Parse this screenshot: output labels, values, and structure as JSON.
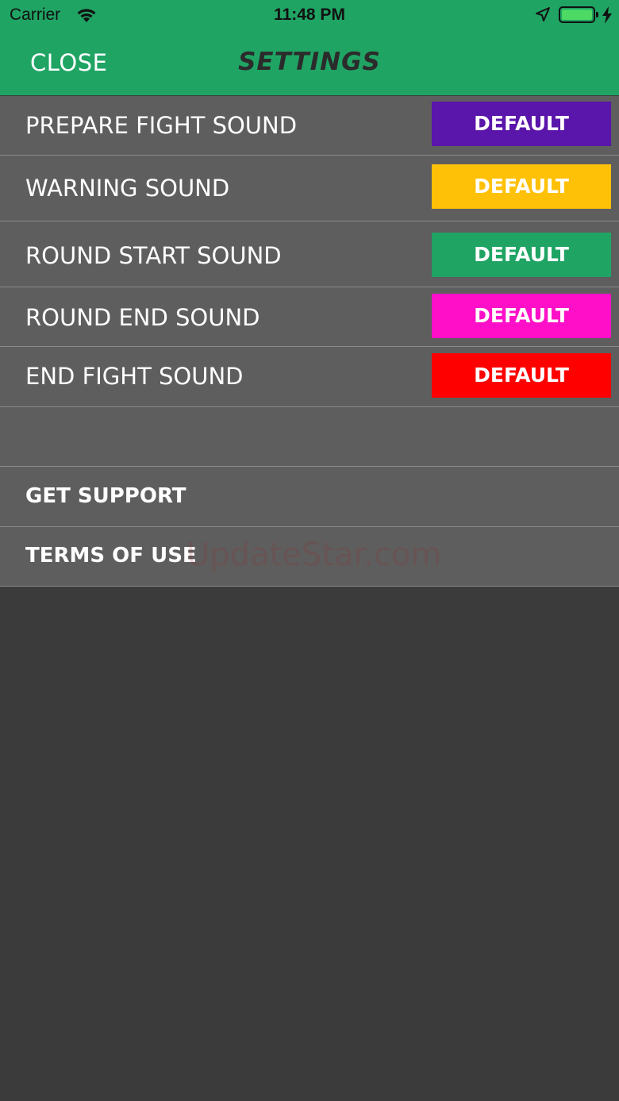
{
  "status_bar": {
    "carrier": "Carrier",
    "time": "11:48 PM"
  },
  "header": {
    "close_label": "CLOSE",
    "title": "SETTINGS"
  },
  "sound_rows": [
    {
      "label": "PREPARE FIGHT SOUND",
      "button": "DEFAULT",
      "color": "#5a15ab"
    },
    {
      "label": "WARNING SOUND",
      "button": "DEFAULT",
      "color": "#ffc107"
    },
    {
      "label": "ROUND START SOUND",
      "button": "DEFAULT",
      "color": "#20a464"
    },
    {
      "label": "ROUND END SOUND",
      "button": "DEFAULT",
      "color": "#ff10c8"
    },
    {
      "label": "END FIGHT SOUND",
      "button": "DEFAULT",
      "color": "#ff0000"
    }
  ],
  "links": [
    {
      "label": "GET SUPPORT"
    },
    {
      "label": "TERMS OF USE"
    }
  ],
  "watermark": "UpdateStar.com",
  "colors": {
    "header": "#20a464",
    "panel": "#5e5e5e",
    "background": "#3b3b3b"
  }
}
